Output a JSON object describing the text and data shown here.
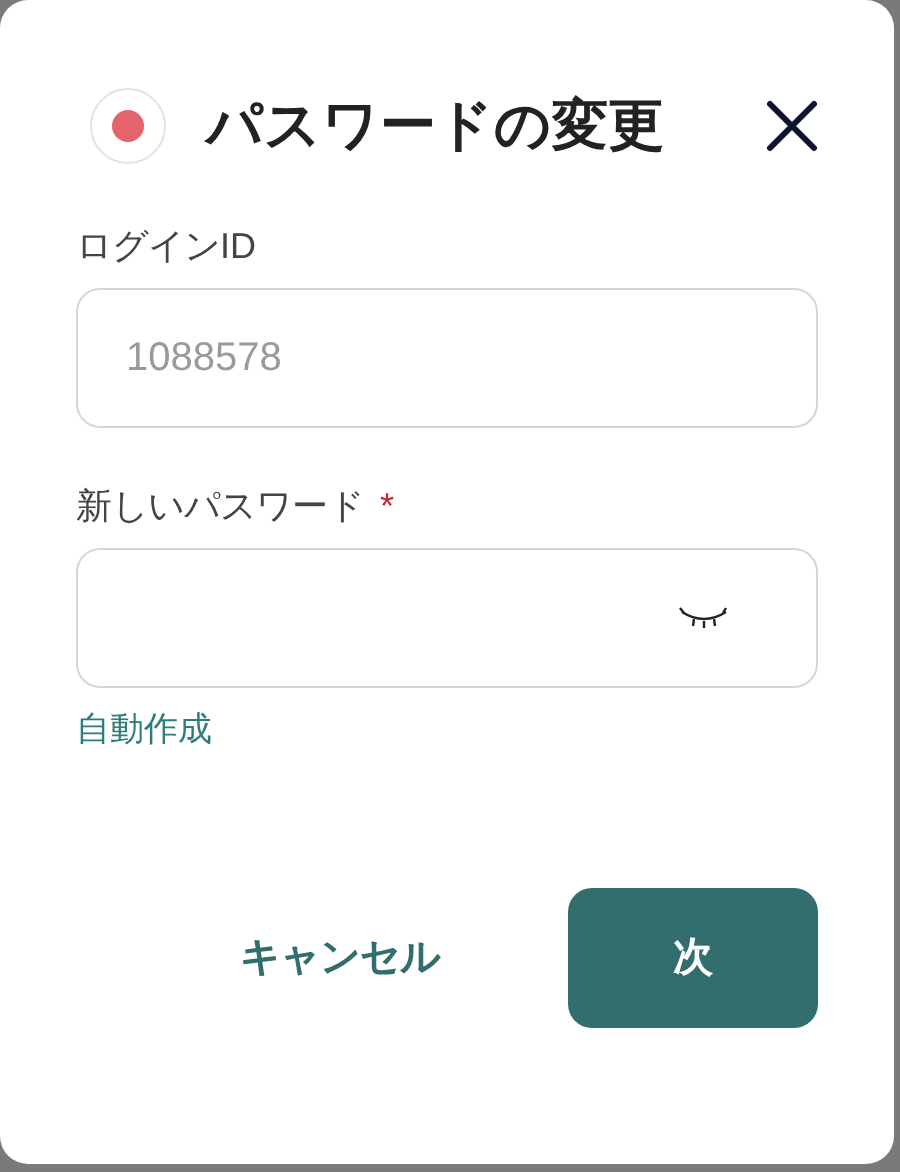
{
  "dialog": {
    "title": "パスワードの変更"
  },
  "fields": [
    {
      "label": "ログインID",
      "placeholder": "1088578",
      "required": false,
      "kind": "text"
    },
    {
      "label": "新しいパスワード",
      "required": true,
      "kind": "password"
    }
  ],
  "required_mark": "*",
  "generate_link": "自動作成",
  "buttons": {
    "cancel": "キャンセル",
    "next": "次"
  }
}
